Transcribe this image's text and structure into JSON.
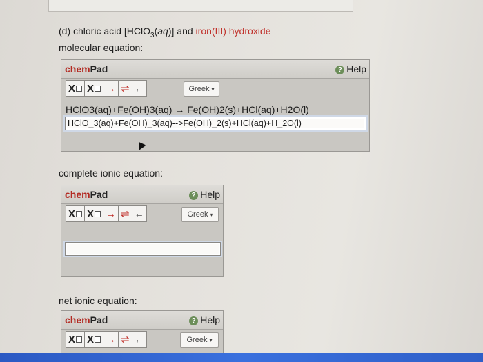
{
  "question": {
    "prefix": "(d) chloric acid [HClO",
    "sub": "3",
    "middle_open": "(",
    "aq": "aq",
    "middle_close": ")]",
    "and": " and ",
    "reactant2": "iron(III) hydroxide",
    "molecular_label": "molecular equation:"
  },
  "pads": [
    {
      "title_chem": "chem",
      "title_pad": "Pad",
      "help": "Help",
      "greek": "Greek",
      "rendered": "HClO3(aq)+Fe(OH)3(aq) → Fe(OH)2(s)+HCl(aq)+H2O(l)",
      "answer": "HClO_3(aq)+Fe(OH)_3(aq)-->Fe(OH)_2(s)+HCl(aq)+H_2O(l)"
    },
    {
      "title_chem": "chem",
      "title_pad": "Pad",
      "help": "Help",
      "greek": "Greek",
      "answer": ""
    },
    {
      "title_chem": "chem",
      "title_pad": "Pad",
      "help": "Help",
      "greek": "Greek"
    }
  ],
  "labels": {
    "complete": "complete ionic equation:",
    "net": "net ionic equation:"
  },
  "toolbar": {
    "subscript": "X",
    "superscript": "X",
    "arrow": "→",
    "equilibrium": "⇌",
    "backspace": "←"
  },
  "icons": {
    "help": "question-circle-icon",
    "greek_caret": "▾"
  }
}
